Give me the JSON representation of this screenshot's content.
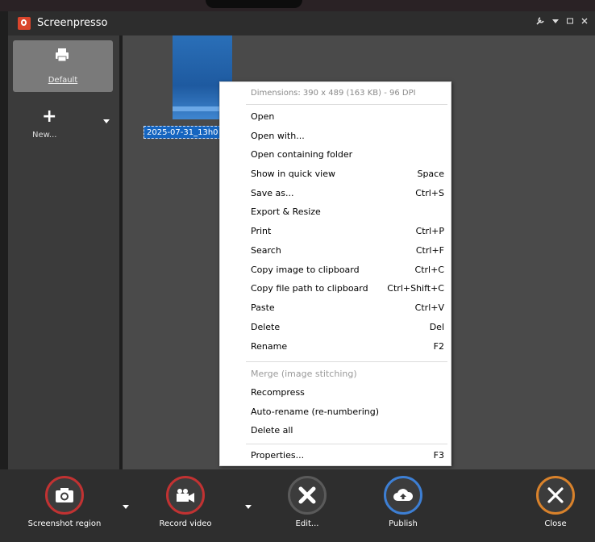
{
  "window": {
    "title": "Screenpresso",
    "controls": [
      "tools-icon",
      "chevron-down-icon",
      "restore-icon",
      "close-icon"
    ]
  },
  "sidebar": {
    "profiles": [
      {
        "label": "Default",
        "icon": "printer-icon",
        "selected": true
      },
      {
        "label": "New...",
        "icon": "plus-icon",
        "selected": false
      }
    ]
  },
  "content": {
    "thumbnail_label": "2025-07-31_13h0"
  },
  "context_menu": {
    "header": "Dimensions: 390 x 489 (163 KB) - 96 DPI",
    "items": [
      {
        "label": "Open",
        "shortcut": ""
      },
      {
        "label": "Open with...",
        "shortcut": ""
      },
      {
        "label": "Open containing folder",
        "shortcut": ""
      },
      {
        "label": "Show in quick view",
        "shortcut": "Space"
      },
      {
        "label": "Save as...",
        "shortcut": "Ctrl+S"
      },
      {
        "label": "Export & Resize",
        "shortcut": ""
      },
      {
        "label": "Print",
        "shortcut": "Ctrl+P"
      },
      {
        "label": "Search",
        "shortcut": "Ctrl+F"
      },
      {
        "label": "Copy image to clipboard",
        "shortcut": "Ctrl+C"
      },
      {
        "label": "Copy file path to clipboard",
        "shortcut": "Ctrl+Shift+C"
      },
      {
        "label": "Paste",
        "shortcut": "Ctrl+V"
      },
      {
        "label": "Delete",
        "shortcut": "Del"
      },
      {
        "label": "Rename",
        "shortcut": "F2"
      }
    ],
    "items_group2": [
      {
        "label": "Merge (image stitching)",
        "shortcut": "",
        "disabled": true
      },
      {
        "label": "Recompress",
        "shortcut": ""
      },
      {
        "label": "Auto-rename (re-numbering)",
        "shortcut": ""
      },
      {
        "label": "Delete all",
        "shortcut": ""
      }
    ],
    "items_group3": [
      {
        "label": "Properties...",
        "shortcut": "F3"
      }
    ]
  },
  "toolbar": {
    "screenshot_label": "Screenshot region",
    "record_label": "Record video",
    "edit_label": "Edit...",
    "publish_label": "Publish",
    "close_label": "Close"
  },
  "colors": {
    "accent_red": "#c23232",
    "accent_blue": "#3d7fd4",
    "accent_orange": "#d9822b",
    "selection_blue": "#1565c0"
  }
}
